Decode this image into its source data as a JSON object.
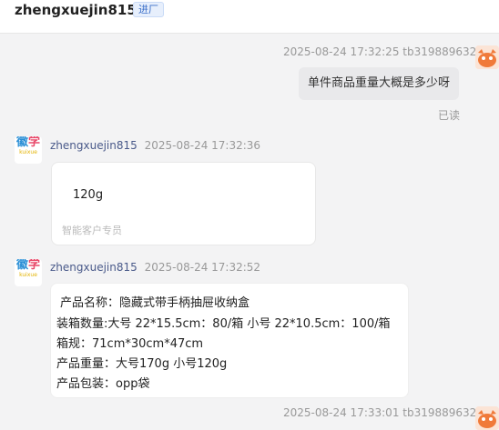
{
  "header": {
    "title": "zhengxuejin815",
    "tag": "进厂"
  },
  "messages": {
    "m1": {
      "timestamp": "2025-08-24 17:32:25",
      "sender": "tb319889632",
      "text": "单件商品重量大概是多少呀",
      "status": "已读"
    },
    "m2": {
      "sender": "zhengxuejin815",
      "timestamp": "2025-08-24 17:32:36",
      "text": "120g",
      "footer": "智能客户专员"
    },
    "m3": {
      "sender": "zhengxuejin815",
      "timestamp": "2025-08-24 17:32:52",
      "lines": [
        "产品名称：隐藏式带手柄抽屉收纳盒",
        "装箱数量:大号 22*15.5cm：80/箱     小号 22*10.5cm：100/箱",
        "箱规：71cm*30cm*47cm",
        "产品重量：大号170g   小号120g",
        "产品包装：opp袋"
      ]
    },
    "m4": {
      "timestamp": "2025-08-24 17:33:01",
      "sender": "tb319889632"
    }
  },
  "avatar_glyphs": {
    "left_top": "徽",
    "left_bottom": "学",
    "left_sub": "kuixue"
  },
  "colors": {
    "background": "#f3f3f4",
    "bubble_self": "#e9e9eb",
    "nickname": "#4a5a8a",
    "tag": "#3b6fc9"
  }
}
